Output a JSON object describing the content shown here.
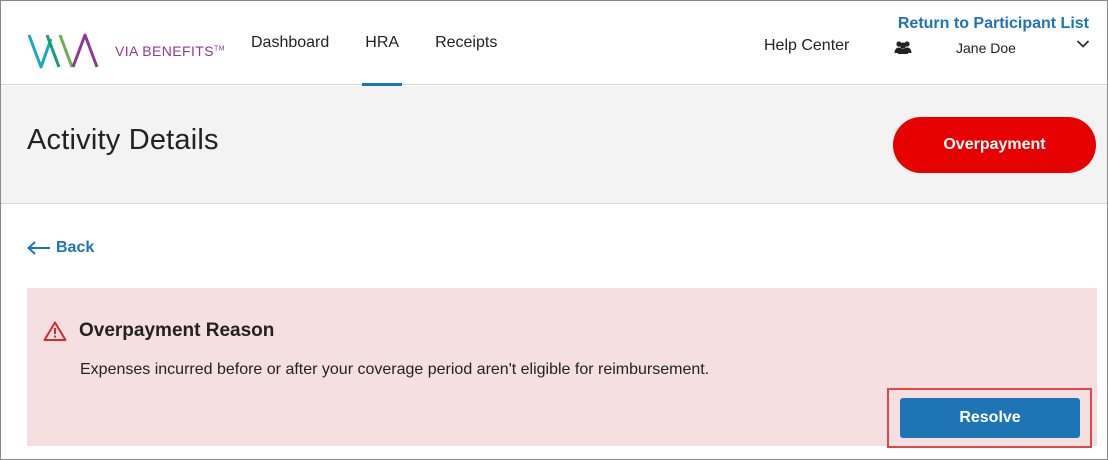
{
  "brand": {
    "name": "VIA BENEFITS",
    "trademark": "TM"
  },
  "nav": {
    "items": [
      {
        "label": "Dashboard",
        "active": false
      },
      {
        "label": "HRA",
        "active": true
      },
      {
        "label": "Receipts",
        "active": false
      }
    ],
    "help_label": "Help Center",
    "return_label": "Return to Participant List",
    "user_name": "Jane Doe",
    "user_icon": "users-icon",
    "menu_icon": "chevron-down-icon"
  },
  "page": {
    "title": "Activity Details",
    "status": "Overpayment",
    "status_color": "#e60000"
  },
  "back": {
    "label": "Back",
    "icon": "arrow-left-icon"
  },
  "alert": {
    "icon": "warning-triangle-icon",
    "title": "Overpayment Reason",
    "message": "Expenses incurred before or after your coverage period aren't eligible for reimbursement.",
    "action_label": "Resolve",
    "background": "#f5dfe1"
  },
  "colors": {
    "accent": "#1f74b5",
    "brand_purple": "#8d3b8f"
  }
}
